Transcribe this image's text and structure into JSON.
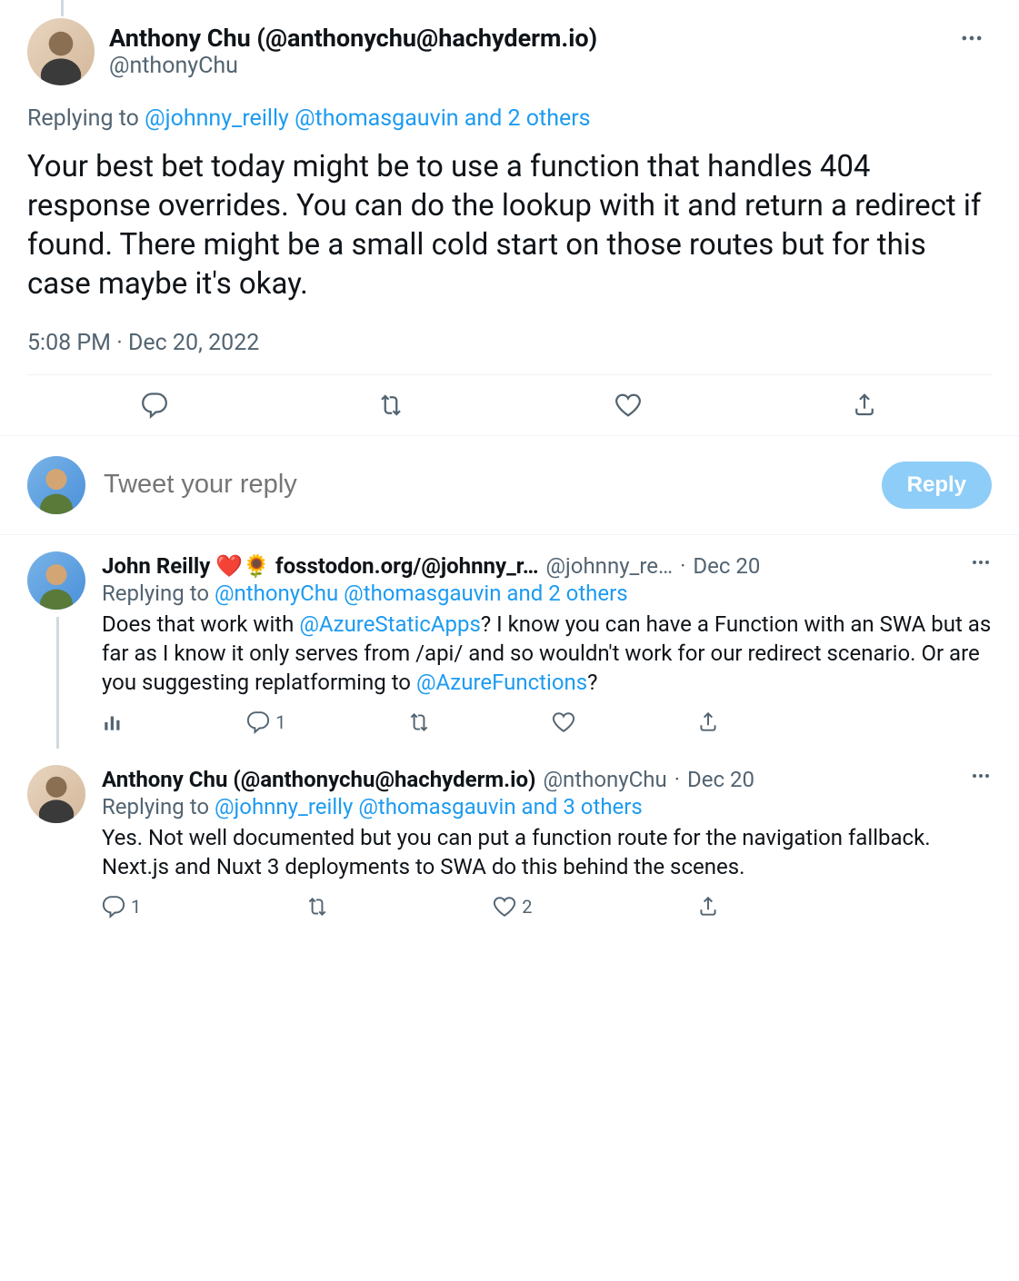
{
  "main": {
    "author_name": "Anthony Chu (@anthonychu@hachyderm.io)",
    "author_handle": "@nthonyChu",
    "replying_prefix": "Replying to ",
    "replying_handle1": "@johnny_reilly",
    "replying_handle2": "@thomasgauvin",
    "replying_others": " and 2 others",
    "body": "Your best bet today might be to use a function that handles 404 response overrides. You can do the lookup with it and return a redirect if found. There might be a small cold start on those routes but for this case maybe it's okay.",
    "timestamp": "5:08 PM · Dec 20, 2022"
  },
  "compose": {
    "placeholder": "Tweet your reply",
    "button": "Reply"
  },
  "replies": [
    {
      "name": "John Reilly ❤️🌻 fosstodon.org/@johnny_r…",
      "handle": "@johnny_re…",
      "date": "Dec 20",
      "replying_prefix": "Replying to ",
      "replying_h1": "@nthonyChu",
      "replying_h2": "@thomasgauvin",
      "replying_others": " and 2 others",
      "text_p1": "Does that work with ",
      "mention1": "@AzureStaticApps",
      "text_p2": "? I know you can have a Function with an SWA but as far as I know it only serves from /api/ and so wouldn't work for our redirect scenario. Or are you suggesting replatforming to ",
      "mention2": "@AzureFunctions",
      "text_p3": "?",
      "reply_count": "1"
    },
    {
      "name": "Anthony Chu (@anthonychu@hachyderm.io)",
      "handle": "@nthonyChu",
      "date": "Dec 20",
      "replying_prefix": "Replying to ",
      "replying_h1": "@johnny_reilly",
      "replying_h2": "@thomasgauvin",
      "replying_others": " and 3 others",
      "text": "Yes. Not well documented but you can put a function route for the navigation fallback. Next.js and Nuxt 3 deployments to SWA do this behind the scenes.",
      "reply_count": "1",
      "like_count": "2"
    }
  ]
}
